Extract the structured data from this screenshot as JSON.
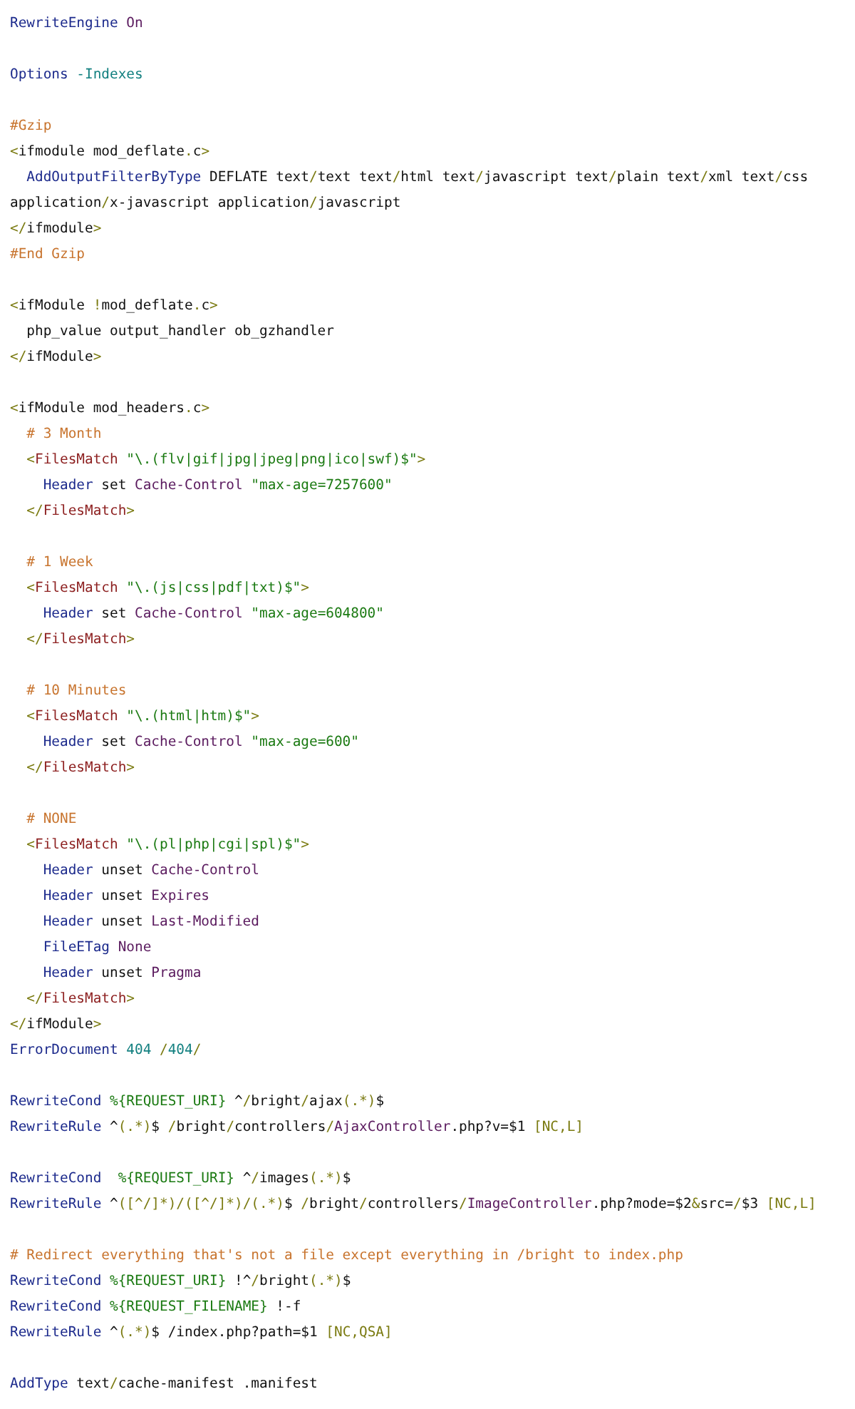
{
  "code_lines": [
    {
      "kind": "code",
      "tokens": [
        {
          "kind": "keyword",
          "text": "RewriteEngine "
        },
        {
          "kind": "value",
          "text": "On"
        }
      ]
    },
    {
      "kind": "blank"
    },
    {
      "kind": "code",
      "tokens": [
        {
          "kind": "keyword",
          "text": "Options "
        },
        {
          "kind": "number",
          "text": "-Indexes"
        }
      ]
    },
    {
      "kind": "blank"
    },
    {
      "kind": "code",
      "tokens": [
        {
          "kind": "comment",
          "text": "#Gzip"
        }
      ]
    },
    {
      "kind": "code",
      "tokens": [
        {
          "kind": "punct",
          "text": "<"
        },
        {
          "kind": "plain",
          "text": "ifmodule mod_deflate"
        },
        {
          "kind": "punct",
          "text": "."
        },
        {
          "kind": "plain",
          "text": "c"
        },
        {
          "kind": "punct",
          "text": ">"
        }
      ]
    },
    {
      "kind": "code",
      "tokens": [
        {
          "kind": "keyword",
          "text": "  AddOutputFilterByType"
        },
        {
          "kind": "plain",
          "text": " DEFLATE text"
        },
        {
          "kind": "punct",
          "text": "/"
        },
        {
          "kind": "plain",
          "text": "text text"
        },
        {
          "kind": "punct",
          "text": "/"
        },
        {
          "kind": "plain",
          "text": "html text"
        },
        {
          "kind": "punct",
          "text": "/"
        },
        {
          "kind": "plain",
          "text": "javascript text"
        },
        {
          "kind": "punct",
          "text": "/"
        },
        {
          "kind": "plain",
          "text": "plain text"
        },
        {
          "kind": "punct",
          "text": "/"
        },
        {
          "kind": "plain",
          "text": "xml text"
        },
        {
          "kind": "punct",
          "text": "/"
        },
        {
          "kind": "plain",
          "text": "css"
        }
      ]
    },
    {
      "kind": "code",
      "tokens": [
        {
          "kind": "plain",
          "text": "application"
        },
        {
          "kind": "punct",
          "text": "/"
        },
        {
          "kind": "plain",
          "text": "x-javascript application"
        },
        {
          "kind": "punct",
          "text": "/"
        },
        {
          "kind": "plain",
          "text": "javascript"
        }
      ]
    },
    {
      "kind": "code",
      "tokens": [
        {
          "kind": "punct",
          "text": "</"
        },
        {
          "kind": "plain",
          "text": "ifmodule"
        },
        {
          "kind": "punct",
          "text": ">"
        }
      ]
    },
    {
      "kind": "code",
      "tokens": [
        {
          "kind": "comment",
          "text": "#End Gzip"
        }
      ]
    },
    {
      "kind": "blank"
    },
    {
      "kind": "code",
      "tokens": [
        {
          "kind": "punct",
          "text": "<"
        },
        {
          "kind": "plain",
          "text": "ifModule "
        },
        {
          "kind": "punct",
          "text": "!"
        },
        {
          "kind": "plain",
          "text": "mod_deflate"
        },
        {
          "kind": "punct",
          "text": "."
        },
        {
          "kind": "plain",
          "text": "c"
        },
        {
          "kind": "punct",
          "text": ">"
        }
      ]
    },
    {
      "kind": "code",
      "tokens": [
        {
          "kind": "plain",
          "text": "  php_value output_handler ob_gzhandler"
        }
      ]
    },
    {
      "kind": "code",
      "tokens": [
        {
          "kind": "punct",
          "text": "</"
        },
        {
          "kind": "plain",
          "text": "ifModule"
        },
        {
          "kind": "punct",
          "text": ">"
        }
      ]
    },
    {
      "kind": "blank"
    },
    {
      "kind": "code",
      "tokens": [
        {
          "kind": "punct",
          "text": "<"
        },
        {
          "kind": "plain",
          "text": "ifModule mod_headers"
        },
        {
          "kind": "punct",
          "text": "."
        },
        {
          "kind": "plain",
          "text": "c"
        },
        {
          "kind": "punct",
          "text": ">"
        }
      ]
    },
    {
      "kind": "code",
      "tokens": [
        {
          "kind": "comment",
          "text": "  # 3 Month"
        }
      ]
    },
    {
      "kind": "code",
      "tokens": [
        {
          "kind": "punct",
          "text": "  <"
        },
        {
          "kind": "tag",
          "text": "FilesMatch "
        },
        {
          "kind": "string",
          "text": "\"\\.(flv|gif|jpg|jpeg|png|ico|swf)$\""
        },
        {
          "kind": "punct",
          "text": ">"
        }
      ]
    },
    {
      "kind": "code",
      "tokens": [
        {
          "kind": "keyword",
          "text": "    Header"
        },
        {
          "kind": "plain",
          "text": " set "
        },
        {
          "kind": "value",
          "text": "Cache-Control "
        },
        {
          "kind": "string",
          "text": "\"max-age=7257600\""
        }
      ]
    },
    {
      "kind": "code",
      "tokens": [
        {
          "kind": "punct",
          "text": "  </"
        },
        {
          "kind": "tag",
          "text": "FilesMatch"
        },
        {
          "kind": "punct",
          "text": ">"
        }
      ]
    },
    {
      "kind": "blank"
    },
    {
      "kind": "code",
      "tokens": [
        {
          "kind": "comment",
          "text": "  # 1 Week"
        }
      ]
    },
    {
      "kind": "code",
      "tokens": [
        {
          "kind": "punct",
          "text": "  <"
        },
        {
          "kind": "tag",
          "text": "FilesMatch "
        },
        {
          "kind": "string",
          "text": "\"\\.(js|css|pdf|txt)$\""
        },
        {
          "kind": "punct",
          "text": ">"
        }
      ]
    },
    {
      "kind": "code",
      "tokens": [
        {
          "kind": "keyword",
          "text": "    Header"
        },
        {
          "kind": "plain",
          "text": " set "
        },
        {
          "kind": "value",
          "text": "Cache-Control "
        },
        {
          "kind": "string",
          "text": "\"max-age=604800\""
        }
      ]
    },
    {
      "kind": "code",
      "tokens": [
        {
          "kind": "punct",
          "text": "  </"
        },
        {
          "kind": "tag",
          "text": "FilesMatch"
        },
        {
          "kind": "punct",
          "text": ">"
        }
      ]
    },
    {
      "kind": "blank"
    },
    {
      "kind": "code",
      "tokens": [
        {
          "kind": "comment",
          "text": "  # 10 Minutes"
        }
      ]
    },
    {
      "kind": "code",
      "tokens": [
        {
          "kind": "punct",
          "text": "  <"
        },
        {
          "kind": "tag",
          "text": "FilesMatch "
        },
        {
          "kind": "string",
          "text": "\"\\.(html|htm)$\""
        },
        {
          "kind": "punct",
          "text": ">"
        }
      ]
    },
    {
      "kind": "code",
      "tokens": [
        {
          "kind": "keyword",
          "text": "    Header"
        },
        {
          "kind": "plain",
          "text": " set "
        },
        {
          "kind": "value",
          "text": "Cache-Control "
        },
        {
          "kind": "string",
          "text": "\"max-age=600\""
        }
      ]
    },
    {
      "kind": "code",
      "tokens": [
        {
          "kind": "punct",
          "text": "  </"
        },
        {
          "kind": "tag",
          "text": "FilesMatch"
        },
        {
          "kind": "punct",
          "text": ">"
        }
      ]
    },
    {
      "kind": "blank"
    },
    {
      "kind": "code",
      "tokens": [
        {
          "kind": "comment",
          "text": "  # NONE"
        }
      ]
    },
    {
      "kind": "code",
      "tokens": [
        {
          "kind": "punct",
          "text": "  <"
        },
        {
          "kind": "tag",
          "text": "FilesMatch "
        },
        {
          "kind": "string",
          "text": "\"\\.(pl|php|cgi|spl)$\""
        },
        {
          "kind": "punct",
          "text": ">"
        }
      ]
    },
    {
      "kind": "code",
      "tokens": [
        {
          "kind": "keyword",
          "text": "    Header"
        },
        {
          "kind": "plain",
          "text": " unset "
        },
        {
          "kind": "value",
          "text": "Cache-Control"
        }
      ]
    },
    {
      "kind": "code",
      "tokens": [
        {
          "kind": "keyword",
          "text": "    Header"
        },
        {
          "kind": "plain",
          "text": " unset "
        },
        {
          "kind": "value",
          "text": "Expires"
        }
      ]
    },
    {
      "kind": "code",
      "tokens": [
        {
          "kind": "keyword",
          "text": "    Header"
        },
        {
          "kind": "plain",
          "text": " unset "
        },
        {
          "kind": "value",
          "text": "Last-Modified"
        }
      ]
    },
    {
      "kind": "code",
      "tokens": [
        {
          "kind": "keyword",
          "text": "    FileETag "
        },
        {
          "kind": "value",
          "text": "None"
        }
      ]
    },
    {
      "kind": "code",
      "tokens": [
        {
          "kind": "keyword",
          "text": "    Header"
        },
        {
          "kind": "plain",
          "text": " unset "
        },
        {
          "kind": "value",
          "text": "Pragma"
        }
      ]
    },
    {
      "kind": "code",
      "tokens": [
        {
          "kind": "punct",
          "text": "  </"
        },
        {
          "kind": "tag",
          "text": "FilesMatch"
        },
        {
          "kind": "punct",
          "text": ">"
        }
      ]
    },
    {
      "kind": "code",
      "tokens": [
        {
          "kind": "punct",
          "text": "</"
        },
        {
          "kind": "plain",
          "text": "ifModule"
        },
        {
          "kind": "punct",
          "text": ">"
        }
      ]
    },
    {
      "kind": "code",
      "tokens": [
        {
          "kind": "keyword",
          "text": "ErrorDocument "
        },
        {
          "kind": "number",
          "text": "404 "
        },
        {
          "kind": "punct",
          "text": "/"
        },
        {
          "kind": "number",
          "text": "404"
        },
        {
          "kind": "punct",
          "text": "/"
        }
      ]
    },
    {
      "kind": "blank"
    },
    {
      "kind": "code",
      "tokens": [
        {
          "kind": "keyword",
          "text": "RewriteCond "
        },
        {
          "kind": "string",
          "text": "%{REQUEST_URI}"
        },
        {
          "kind": "plain",
          "text": " ^"
        },
        {
          "kind": "punct",
          "text": "/"
        },
        {
          "kind": "plain",
          "text": "bright"
        },
        {
          "kind": "punct",
          "text": "/"
        },
        {
          "kind": "plain",
          "text": "ajax"
        },
        {
          "kind": "punct",
          "text": "(.*)"
        },
        {
          "kind": "plain",
          "text": "$"
        }
      ]
    },
    {
      "kind": "code",
      "tokens": [
        {
          "kind": "keyword",
          "text": "RewriteRule"
        },
        {
          "kind": "plain",
          "text": " ^"
        },
        {
          "kind": "punct",
          "text": "(.*)"
        },
        {
          "kind": "plain",
          "text": "$ "
        },
        {
          "kind": "punct",
          "text": "/"
        },
        {
          "kind": "plain",
          "text": "bright"
        },
        {
          "kind": "punct",
          "text": "/"
        },
        {
          "kind": "plain",
          "text": "controllers"
        },
        {
          "kind": "punct",
          "text": "/"
        },
        {
          "kind": "value",
          "text": "AjaxController"
        },
        {
          "kind": "plain",
          "text": ".php?v=$1 "
        },
        {
          "kind": "punct",
          "text": "[NC,L]"
        }
      ]
    },
    {
      "kind": "blank"
    },
    {
      "kind": "code",
      "tokens": [
        {
          "kind": "keyword",
          "text": "RewriteCond  "
        },
        {
          "kind": "string",
          "text": "%{REQUEST_URI}"
        },
        {
          "kind": "plain",
          "text": " ^"
        },
        {
          "kind": "punct",
          "text": "/"
        },
        {
          "kind": "plain",
          "text": "images"
        },
        {
          "kind": "punct",
          "text": "(.*)"
        },
        {
          "kind": "plain",
          "text": "$"
        }
      ]
    },
    {
      "kind": "code",
      "tokens": [
        {
          "kind": "keyword",
          "text": "RewriteRule"
        },
        {
          "kind": "plain",
          "text": " ^"
        },
        {
          "kind": "punct",
          "text": "([^/]*)/([^/]*)/(.*)"
        },
        {
          "kind": "plain",
          "text": "$ "
        },
        {
          "kind": "punct",
          "text": "/"
        },
        {
          "kind": "plain",
          "text": "bright"
        },
        {
          "kind": "punct",
          "text": "/"
        },
        {
          "kind": "plain",
          "text": "controllers"
        },
        {
          "kind": "punct",
          "text": "/"
        },
        {
          "kind": "value",
          "text": "ImageController"
        },
        {
          "kind": "plain",
          "text": ".php?mode=$2"
        },
        {
          "kind": "punct",
          "text": "&"
        },
        {
          "kind": "plain",
          "text": "src="
        },
        {
          "kind": "punct",
          "text": "/"
        },
        {
          "kind": "plain",
          "text": "$3 "
        },
        {
          "kind": "punct",
          "text": "[NC,L]"
        }
      ]
    },
    {
      "kind": "blank"
    },
    {
      "kind": "code",
      "tokens": [
        {
          "kind": "comment",
          "text": "# Redirect everything that's not a file except everything in /bright to index.php"
        }
      ]
    },
    {
      "kind": "code",
      "tokens": [
        {
          "kind": "keyword",
          "text": "RewriteCond "
        },
        {
          "kind": "string",
          "text": "%{REQUEST_URI}"
        },
        {
          "kind": "plain",
          "text": " !^"
        },
        {
          "kind": "punct",
          "text": "/"
        },
        {
          "kind": "plain",
          "text": "bright"
        },
        {
          "kind": "punct",
          "text": "(.*)"
        },
        {
          "kind": "plain",
          "text": "$"
        }
      ]
    },
    {
      "kind": "code",
      "tokens": [
        {
          "kind": "keyword",
          "text": "RewriteCond "
        },
        {
          "kind": "string",
          "text": "%{REQUEST_FILENAME}"
        },
        {
          "kind": "plain",
          "text": " !-f"
        }
      ]
    },
    {
      "kind": "code",
      "tokens": [
        {
          "kind": "keyword",
          "text": "RewriteRule"
        },
        {
          "kind": "plain",
          "text": " ^"
        },
        {
          "kind": "punct",
          "text": "(.*)"
        },
        {
          "kind": "plain",
          "text": "$ /index.php?path=$1 "
        },
        {
          "kind": "punct",
          "text": "[NC,QSA]"
        }
      ]
    },
    {
      "kind": "blank"
    },
    {
      "kind": "code",
      "tokens": [
        {
          "kind": "keyword",
          "text": "AddType"
        },
        {
          "kind": "plain",
          "text": " text"
        },
        {
          "kind": "punct",
          "text": "/"
        },
        {
          "kind": "plain",
          "text": "cache-manifest .manifest"
        }
      ]
    }
  ]
}
